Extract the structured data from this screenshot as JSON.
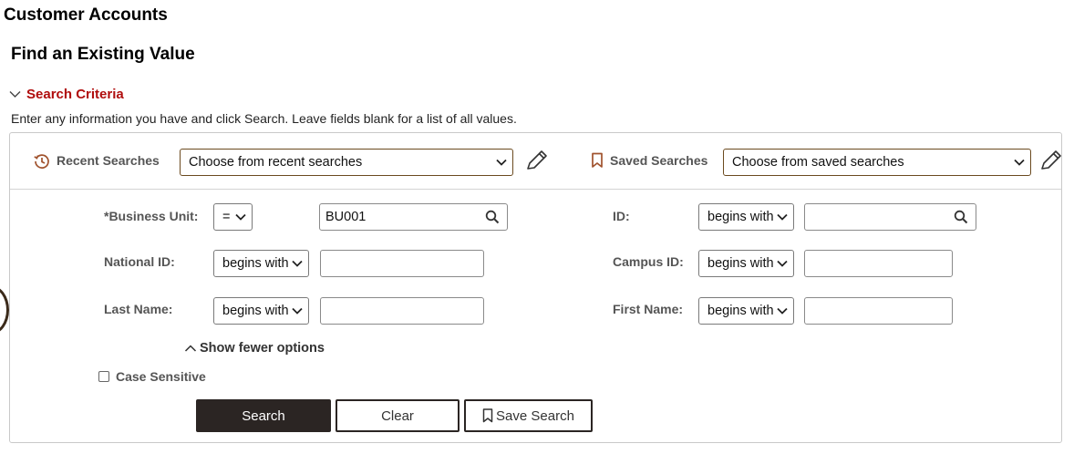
{
  "page": {
    "title": "Customer Accounts",
    "subtitle": "Find an Existing Value"
  },
  "search_criteria": {
    "label": "Search Criteria",
    "instructions": "Enter any information you have and click Search. Leave fields blank for a list of all values."
  },
  "recent_searches": {
    "label": "Recent Searches",
    "value": "Choose from recent searches"
  },
  "saved_searches": {
    "label": "Saved Searches",
    "value": "Choose from saved searches"
  },
  "fields": {
    "business_unit": {
      "label": "*Business Unit:",
      "operator": "=",
      "value": "BU001"
    },
    "id": {
      "label": "ID:",
      "operator": "begins with",
      "value": ""
    },
    "national_id": {
      "label": "National ID:",
      "operator": "begins with",
      "value": ""
    },
    "campus_id": {
      "label": "Campus ID:",
      "operator": "begins with",
      "value": ""
    },
    "last_name": {
      "label": "Last Name:",
      "operator": "begins with",
      "value": ""
    },
    "first_name": {
      "label": "First Name:",
      "operator": "begins with",
      "value": ""
    }
  },
  "options": {
    "show_fewer": "Show fewer options",
    "case_sensitive": "Case Sensitive",
    "case_sensitive_checked": false
  },
  "buttons": {
    "search": "Search",
    "clear": "Clear",
    "save_search": "Save Search"
  },
  "icons": {
    "recent": "history-icon",
    "saved": "bookmark-icon",
    "edit": "pencil-icon",
    "lookup": "search-icon",
    "collapse": "chevron-down-icon",
    "fewer": "chevron-up-icon"
  },
  "colors": {
    "accent": "#b00d0d",
    "primary_button": "#2b2523",
    "icon_brown": "#a0522d"
  }
}
